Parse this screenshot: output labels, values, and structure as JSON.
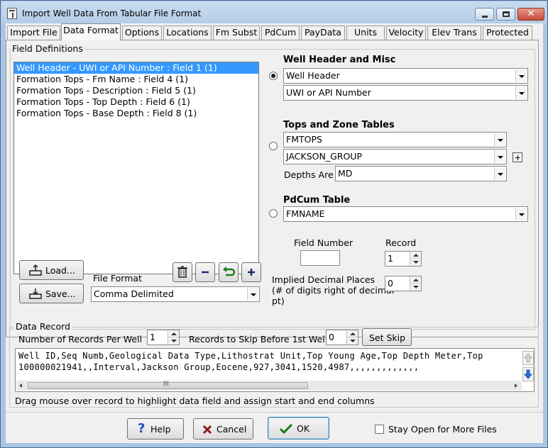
{
  "window": {
    "title": "Import Well Data From Tabular File Format",
    "close_glyph": "✕"
  },
  "tabs": [
    {
      "label": "Import File",
      "active": false
    },
    {
      "label": "Data Format",
      "active": true
    },
    {
      "label": "Options",
      "active": false
    },
    {
      "label": "Locations",
      "active": false
    },
    {
      "label": "Fm Subst",
      "active": false
    },
    {
      "label": "PdCum",
      "active": false
    },
    {
      "label": "PayData",
      "active": false
    },
    {
      "label": "Units",
      "active": false
    },
    {
      "label": "Velocity",
      "active": false
    },
    {
      "label": "Elev Trans",
      "active": false
    },
    {
      "label": "Protected",
      "active": false
    }
  ],
  "field_definitions": {
    "group_label": "Field Definitions",
    "items": [
      {
        "label": "Well Header - UWI or API Number : Field 1 (1)",
        "selected": true
      },
      {
        "label": "Formation Tops - Fm Name : Field 4 (1)",
        "selected": false
      },
      {
        "label": "Formation Tops - Description : Field 5 (1)",
        "selected": false
      },
      {
        "label": "Formation Tops - Top Depth : Field 6 (1)",
        "selected": false
      },
      {
        "label": "Formation Tops - Base Depth : Field 8 (1)",
        "selected": false
      }
    ],
    "load_label": "Load...",
    "save_label": "Save...",
    "file_format_label": "File Format",
    "file_format_value": "Comma Delimited"
  },
  "well_header": {
    "title": "Well Header and Misc",
    "selected": true,
    "combo1": "Well Header",
    "combo2": "UWI or API Number"
  },
  "tops_zone": {
    "title": "Tops and Zone Tables",
    "selected": false,
    "combo1": "FMTOPS",
    "combo2": "JACKSON_GROUP",
    "depths_label": "Depths Are",
    "depths_value": "MD"
  },
  "pdcum": {
    "title": "PdCum Table",
    "selected": false,
    "combo1": "FMNAME"
  },
  "field_number": {
    "label": "Field Number",
    "value": ""
  },
  "record": {
    "label": "Record",
    "value": "1"
  },
  "implied_decimal": {
    "label_line1": "Implied Decimal Places",
    "label_line2": "(# of digits right of decimal",
    "label_line3": "pt)",
    "value": "0"
  },
  "data_record": {
    "group_label": "Data Record",
    "records_per_well_label": "Number of Records Per Well",
    "records_per_well_value": "1",
    "skip_label": "Records to Skip Before 1st Well",
    "skip_value": "0",
    "set_skip_label": "Set Skip",
    "line1": "Well ID,Seq Numb,Geological Data Type,Lithostrat Unit,Top Young Age,Top Depth Meter,Top",
    "line2": "100000021941,,Interval,Jackson Group,Eocene,927,3041,1520,4987,,,,,,,,,,,,,",
    "scroll_grip": "III",
    "hint": "Drag mouse over record to highlight data field and assign start and end columns"
  },
  "bottom": {
    "help_label": "Help",
    "cancel_label": "Cancel",
    "ok_label": "OK",
    "stay_open_label": "Stay Open for More Files",
    "stay_open_checked": false
  },
  "colors": {
    "selection": "#3399ff",
    "help_icon": "#1f4fbf",
    "cancel_icon": "#8b1a1a",
    "ok_icon": "#1a7a1a"
  }
}
